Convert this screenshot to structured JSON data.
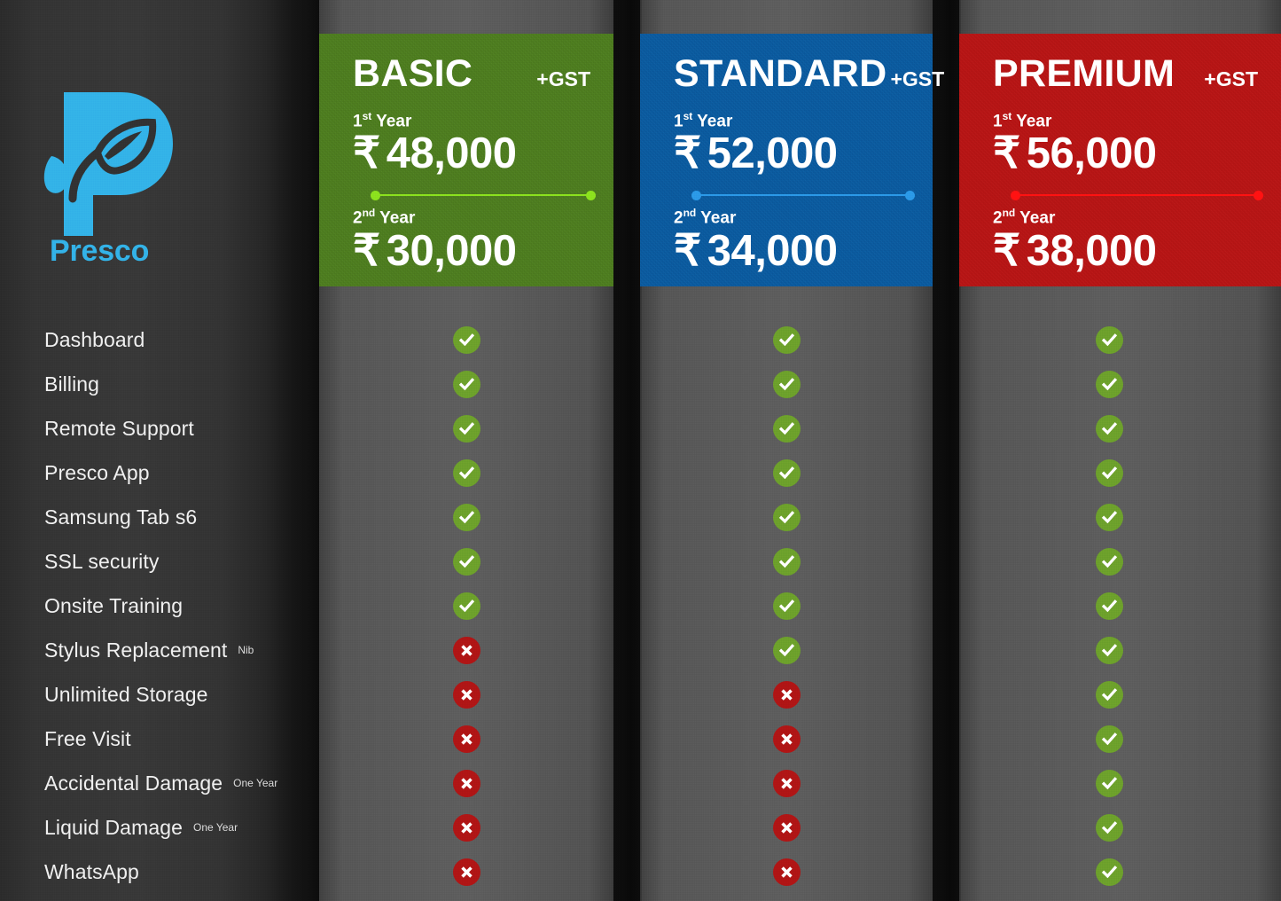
{
  "brand": {
    "name": "Presco",
    "logo_icon": "presco-leaf-p-logo",
    "logo_color": "#33b3e8"
  },
  "plans": [
    {
      "id": "basic",
      "name": "BASIC",
      "gst_label": "+GST",
      "accent_color": "#4d7d1f",
      "line_color": "#8ce21e",
      "first_year_label": "1st Year",
      "first_year_sup": "st",
      "first_year_num": "1",
      "first_year_price": "48,000",
      "second_year_label": "2nd Year",
      "second_year_sup": "nd",
      "second_year_num": "2",
      "second_year_price": "30,000",
      "currency": "₹"
    },
    {
      "id": "standard",
      "name": "STANDARD",
      "gst_label": "+GST",
      "accent_color": "#0a5ba0",
      "line_color": "#2b9ae8",
      "first_year_label": "1st Year",
      "first_year_sup": "st",
      "first_year_num": "1",
      "first_year_price": "52,000",
      "second_year_label": "2nd Year",
      "second_year_sup": "nd",
      "second_year_num": "2",
      "second_year_price": "34,000",
      "currency": "₹"
    },
    {
      "id": "premium",
      "name": "PREMIUM",
      "gst_label": "+GST",
      "accent_color": "#b81414",
      "line_color": "#ff1212",
      "first_year_label": "1st Year",
      "first_year_sup": "st",
      "first_year_num": "1",
      "first_year_price": "56,000",
      "second_year_label": "2nd Year",
      "second_year_sup": "nd",
      "second_year_num": "2",
      "second_year_price": "38,000",
      "currency": "₹"
    }
  ],
  "features": [
    {
      "label": "Dashboard",
      "note": ""
    },
    {
      "label": "Billing",
      "note": ""
    },
    {
      "label": "Remote Support",
      "note": ""
    },
    {
      "label": "Presco App",
      "note": ""
    },
    {
      "label": "Samsung Tab s6",
      "note": ""
    },
    {
      "label": "SSL security",
      "note": ""
    },
    {
      "label": "Onsite Training",
      "note": ""
    },
    {
      "label": "Stylus Replacement",
      "note": "Nib"
    },
    {
      "label": "Unlimited Storage",
      "note": ""
    },
    {
      "label": "Free Visit",
      "note": ""
    },
    {
      "label": "Accidental Damage",
      "note": "One Year"
    },
    {
      "label": "Liquid Damage",
      "note": "One Year"
    },
    {
      "label": "WhatsApp",
      "note": ""
    }
  ],
  "matrix": {
    "basic": [
      "yes",
      "yes",
      "yes",
      "yes",
      "yes",
      "yes",
      "yes",
      "no",
      "no",
      "no",
      "no",
      "no",
      "no"
    ],
    "standard": [
      "yes",
      "yes",
      "yes",
      "yes",
      "yes",
      "yes",
      "yes",
      "yes",
      "no",
      "no",
      "no",
      "no",
      "no"
    ],
    "premium": [
      "yes",
      "yes",
      "yes",
      "yes",
      "yes",
      "yes",
      "yes",
      "yes",
      "yes",
      "yes",
      "yes",
      "yes",
      "yes"
    ]
  },
  "icons": {
    "yes": "check-icon",
    "no": "cross-icon",
    "yes_color": "#6da12b",
    "no_color": "#b01515"
  }
}
